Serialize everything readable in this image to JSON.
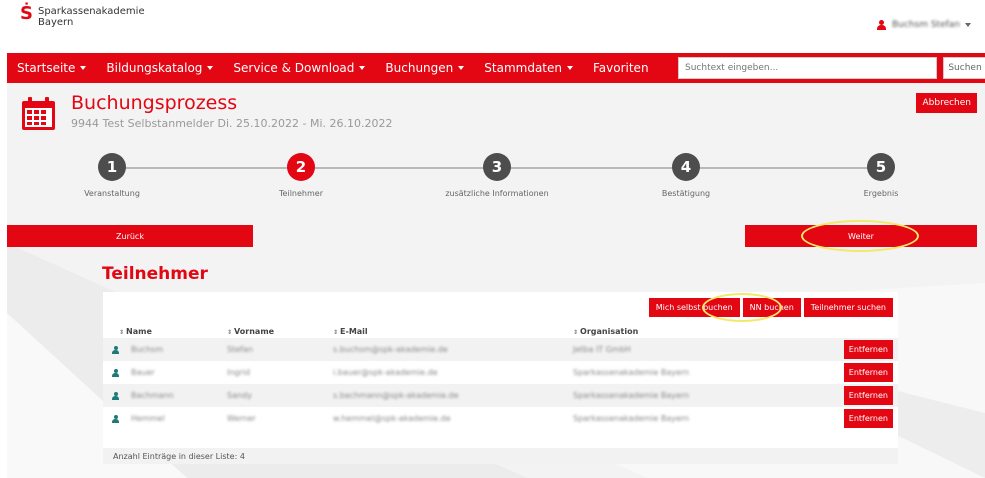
{
  "brand": {
    "logo_mark": "Ṡ",
    "name_line1": "Sparkassenakademie",
    "name_line2": "Bayern",
    "accent_color": "#e30613"
  },
  "user": {
    "name": "Buchsm Stefan"
  },
  "nav": {
    "items": [
      {
        "label": "Startseite",
        "dropdown": true
      },
      {
        "label": "Bildungskatalog",
        "dropdown": true
      },
      {
        "label": "Service & Download",
        "dropdown": true
      },
      {
        "label": "Buchungen",
        "dropdown": true
      },
      {
        "label": "Stammdaten",
        "dropdown": true
      },
      {
        "label": "Favoriten",
        "dropdown": false
      }
    ],
    "search_placeholder": "Suchtext eingeben...",
    "search_button": "Suchen"
  },
  "page": {
    "title": "Buchungsprozess",
    "subtitle": "9944 Test Selbstanmelder Di. 25.10.2022 - Mi. 26.10.2022",
    "cancel_button": "Abbrechen"
  },
  "steps": [
    {
      "number": "1",
      "label": "Veranstaltung",
      "active": false
    },
    {
      "number": "2",
      "label": "Teilnehmer",
      "active": true
    },
    {
      "number": "3",
      "label": "zusätzliche Informationen",
      "active": false
    },
    {
      "number": "4",
      "label": "Bestätigung",
      "active": false
    },
    {
      "number": "5",
      "label": "Ergebnis",
      "active": false
    }
  ],
  "buttons": {
    "back": "Zurück",
    "next": "Weiter"
  },
  "participants": {
    "title": "Teilnehmer",
    "actions": [
      "Mich selbst buchen",
      "NN buchen",
      "Teilnehmer suchen"
    ],
    "columns": [
      "Name",
      "Vorname",
      "E-Mail",
      "Organisation"
    ],
    "rows": [
      {
        "name": "Buchsm",
        "vorname": "Stefan",
        "email": "s.buchsm@spk-akademie.de",
        "org": "Jetba IT GmbH"
      },
      {
        "name": "Bauer",
        "vorname": "Ingrid",
        "email": "i.bauer@spk-akademie.de",
        "org": "Sparkassenakademie Bayern"
      },
      {
        "name": "Bachmann",
        "vorname": "Sandy",
        "email": "s.bachmann@spk-akademie.de",
        "org": "Sparkassenakademie Bayern"
      },
      {
        "name": "Hemmel",
        "vorname": "Werner",
        "email": "w.hemmel@spk-akademie.de",
        "org": "Sparkassenakademie Bayern"
      }
    ],
    "remove_label": "Entfernen",
    "count_text": "Anzahl Einträge in dieser Liste: 4"
  }
}
